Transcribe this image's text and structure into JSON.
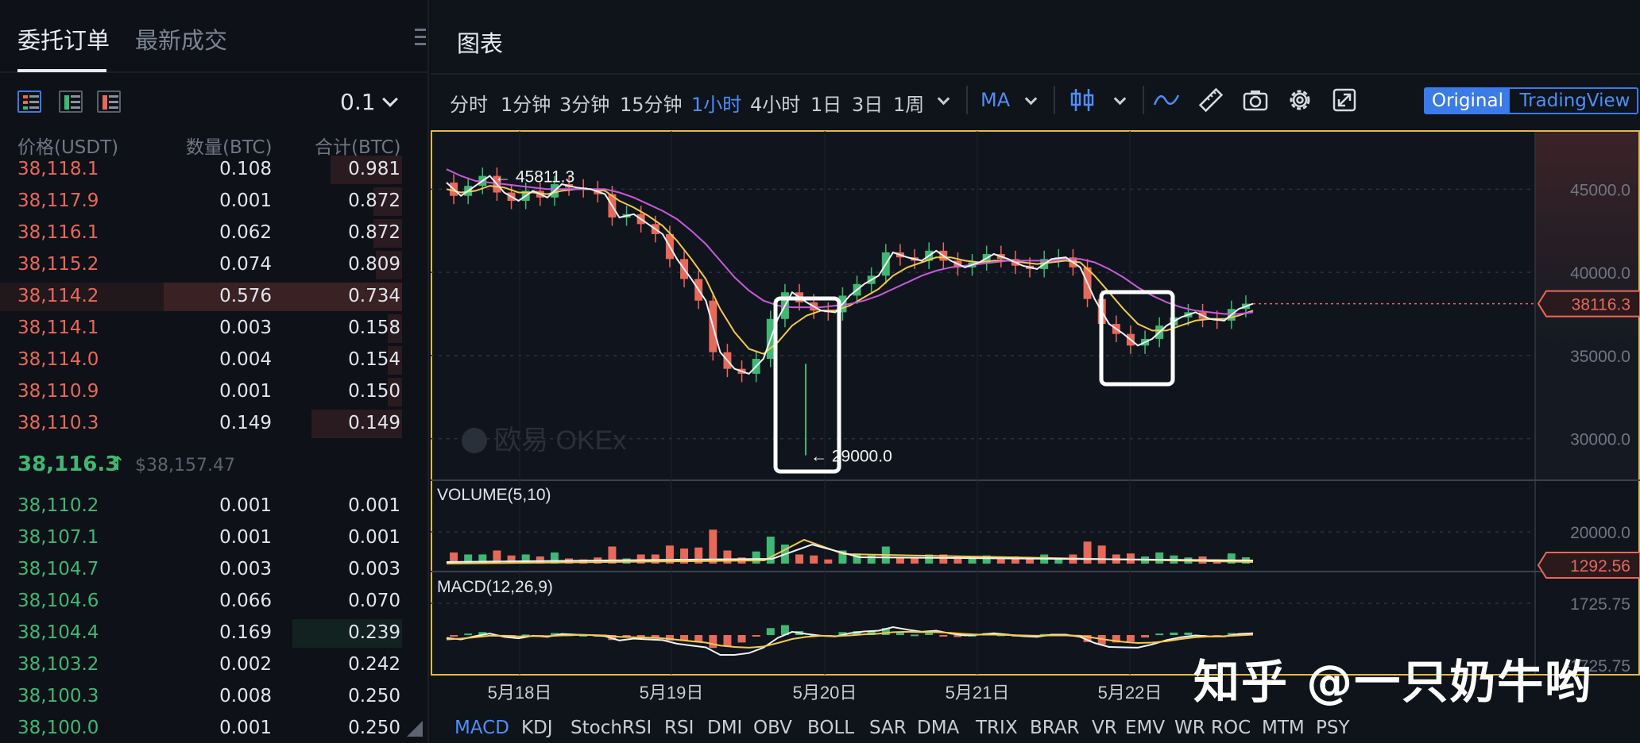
{
  "order_book": {
    "tabs": [
      {
        "label": "委托订单",
        "active": true
      },
      {
        "label": "最新成交",
        "active": false
      }
    ],
    "view_icons": [
      "both-sides-view-icon",
      "bids-view-icon",
      "asks-view-icon"
    ],
    "precision": "0.1",
    "columns": {
      "price": "价格(USDT)",
      "qty": "数量(BTC)",
      "total": "合计(BTC)"
    },
    "asks": [
      {
        "price": "38,118.1",
        "qty": "0.108",
        "total": "0.981",
        "depth": 0.3
      },
      {
        "price": "38,117.9",
        "qty": "0.001",
        "total": "0.872",
        "depth": 0.12
      },
      {
        "price": "38,116.1",
        "qty": "0.062",
        "total": "0.872",
        "depth": 0.12
      },
      {
        "price": "38,115.2",
        "qty": "0.074",
        "total": "0.809",
        "depth": 0.11
      },
      {
        "price": "38,114.2",
        "qty": "0.576",
        "total": "0.734",
        "depth": 1.0
      },
      {
        "price": "38,114.1",
        "qty": "0.003",
        "total": "0.158",
        "depth": 0.06
      },
      {
        "price": "38,114.0",
        "qty": "0.004",
        "total": "0.154",
        "depth": 0.06
      },
      {
        "price": "38,110.9",
        "qty": "0.001",
        "total": "0.150",
        "depth": 0.06
      },
      {
        "price": "38,110.3",
        "qty": "0.149",
        "total": "0.149",
        "depth": 0.38
      }
    ],
    "last_price": "38,116.3",
    "last_arrow": "↑",
    "index_price": "$38,157.47",
    "bids": [
      {
        "price": "38,110.2",
        "qty": "0.001",
        "total": "0.001",
        "depth": 0.0
      },
      {
        "price": "38,107.1",
        "qty": "0.001",
        "total": "0.001",
        "depth": 0.0
      },
      {
        "price": "38,104.7",
        "qty": "0.003",
        "total": "0.003",
        "depth": 0.0
      },
      {
        "price": "38,104.6",
        "qty": "0.066",
        "total": "0.070",
        "depth": 0.0
      },
      {
        "price": "38,104.4",
        "qty": "0.169",
        "total": "0.239",
        "depth": 0.46
      },
      {
        "price": "38,103.2",
        "qty": "0.002",
        "total": "0.242",
        "depth": 0.0
      },
      {
        "price": "38,100.3",
        "qty": "0.008",
        "total": "0.250",
        "depth": 0.0
      },
      {
        "price": "38,100.0",
        "qty": "0.001",
        "total": "0.250",
        "depth": 0.0
      }
    ]
  },
  "chart_panel": {
    "title": "图表",
    "timeframes": [
      {
        "label": "分时",
        "active": false
      },
      {
        "label": "1分钟",
        "active": false
      },
      {
        "label": "3分钟",
        "active": false
      },
      {
        "label": "15分钟",
        "active": false
      },
      {
        "label": "1小时",
        "active": true
      },
      {
        "label": "4小时",
        "active": false
      },
      {
        "label": "1日",
        "active": false
      },
      {
        "label": "3日",
        "active": false
      },
      {
        "label": "1周",
        "active": false
      }
    ],
    "ma_label": "MA",
    "tools": [
      "candle-type-icon",
      "indicator-wave-icon",
      "ruler-icon",
      "camera-icon",
      "settings-gear-icon",
      "fullscreen-icon"
    ],
    "view_toggle": {
      "original": "Original",
      "tradingview": "TradingView",
      "active": "original"
    },
    "indicators": [
      {
        "label": "MACD",
        "active": true
      },
      {
        "label": "KDJ",
        "active": false
      },
      {
        "label": "StochRSI",
        "active": false
      },
      {
        "label": "RSI",
        "active": false
      },
      {
        "label": "DMI",
        "active": false
      },
      {
        "label": "OBV",
        "active": false
      },
      {
        "label": "BOLL",
        "active": false
      },
      {
        "label": "SAR",
        "active": false
      },
      {
        "label": "DMA",
        "active": false
      },
      {
        "label": "TRIX",
        "active": false
      },
      {
        "label": "BRAR",
        "active": false
      },
      {
        "label": "VR",
        "active": false
      },
      {
        "label": "EMV",
        "active": false
      },
      {
        "label": "WR",
        "active": false
      },
      {
        "label": "ROC",
        "active": false
      },
      {
        "label": "MTM",
        "active": false
      },
      {
        "label": "PSY",
        "active": false
      }
    ],
    "chart_watermark": "欧易 OKEx",
    "overlay_watermark": "知乎 @一只奶牛哟"
  },
  "chart_data": {
    "type": "candlestick",
    "symbol": "BTC/USDT",
    "interval": "1小时",
    "x_ticks": [
      "5月18日",
      "5月19日",
      "5月20日",
      "5月21日",
      "5月22日"
    ],
    "price_axis": {
      "ticks": [
        45000.0,
        40000.0,
        35000.0,
        30000.0
      ],
      "tick_labels": [
        "45000.0",
        "40000.0",
        "35000.0",
        "30000.0"
      ],
      "ylim": [
        27500,
        48500
      ]
    },
    "current_price_label": "38116.3",
    "annotations": [
      {
        "text": "← 45811.3",
        "value": 45811.3
      },
      {
        "text": "← 29000.0",
        "value": 29000.0
      }
    ],
    "price_line": [
      45400,
      44600,
      45200,
      45800,
      44800,
      44300,
      44900,
      44500,
      45300,
      45100,
      45000,
      44700,
      43300,
      43500,
      42900,
      42300,
      40800,
      39600,
      38300,
      35200,
      34200,
      33900,
      34800,
      37200,
      38800,
      38200,
      37700,
      37600,
      38600,
      39300,
      39800,
      41200,
      40900,
      40700,
      41300,
      40700,
      40300,
      40600,
      41100,
      40800,
      40400,
      40200,
      40800,
      40900,
      40300,
      38400,
      36900,
      36300,
      35600,
      36000,
      36800,
      37300,
      37600,
      37200,
      37100,
      37800,
      38116
    ],
    "ma_series": [
      {
        "color": "#f2c94c",
        "values": [
          45000,
          44800,
          44900,
          45200,
          45100,
          44800,
          44800,
          44700,
          44900,
          45000,
          45000,
          44900,
          44300,
          43900,
          43400,
          42800,
          41900,
          40800,
          39600,
          37800,
          36400,
          35400,
          35100,
          35800,
          36800,
          37400,
          37700,
          37700,
          38000,
          38500,
          39000,
          39800,
          40300,
          40600,
          40900,
          40900,
          40700,
          40600,
          40700,
          40700,
          40600,
          40500,
          40600,
          40700,
          40600,
          39800,
          38800,
          37800,
          36900,
          36500,
          36500,
          36800,
          37100,
          37200,
          37200,
          37400,
          37700
        ]
      },
      {
        "color": "#c85ad8",
        "values": [
          46200,
          45800,
          45500,
          45400,
          45300,
          45200,
          45100,
          45000,
          45000,
          45000,
          45000,
          45000,
          44800,
          44500,
          44100,
          43700,
          43200,
          42500,
          41700,
          40700,
          39700,
          38900,
          38300,
          38000,
          37900,
          37900,
          37900,
          38000,
          38100,
          38300,
          38600,
          39000,
          39400,
          39800,
          40100,
          40300,
          40400,
          40500,
          40600,
          40700,
          40700,
          40700,
          40700,
          40800,
          40800,
          40600,
          40200,
          39700,
          39100,
          38600,
          38200,
          37900,
          37700,
          37600,
          37500,
          37500,
          37600
        ]
      }
    ],
    "volume_panel": {
      "label": "VOLUME(5,10)",
      "tick_labels": [
        "20000.0"
      ],
      "current_label": "1292.56"
    },
    "macd_panel": {
      "label": "MACD(12,26,9)",
      "tick_labels": [
        "1725.75",
        "-1725.75"
      ]
    }
  }
}
